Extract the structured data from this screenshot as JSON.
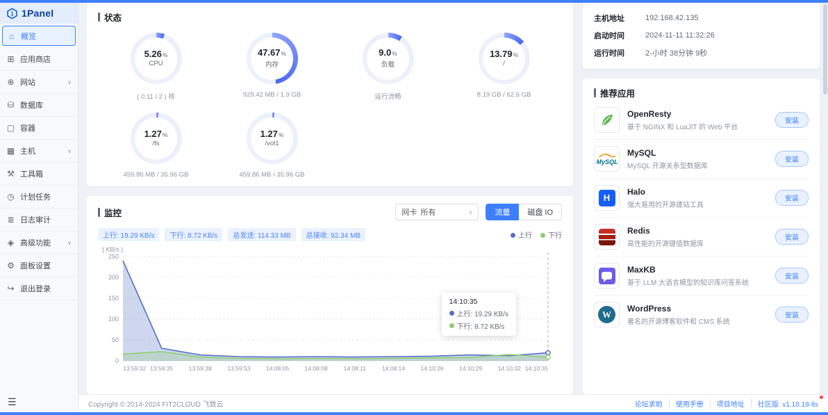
{
  "colors": {
    "primary": "#3d7fff",
    "up_series": "#5470c6",
    "down_series": "#91cc75",
    "danger": "#f54a45"
  },
  "app": {
    "logo_text": "1Panel"
  },
  "sidebar": {
    "items": [
      {
        "label": "概览",
        "selected": true
      },
      {
        "label": "应用商店"
      },
      {
        "label": "网站",
        "expandable": true
      },
      {
        "label": "数据库"
      },
      {
        "label": "容器"
      },
      {
        "label": "主机",
        "expandable": true
      },
      {
        "label": "工具箱"
      },
      {
        "label": "计划任务"
      },
      {
        "label": "日志审计"
      },
      {
        "label": "高级功能",
        "expandable": true
      },
      {
        "label": "面板设置"
      },
      {
        "label": "退出登录"
      }
    ]
  },
  "status": {
    "title": "状态",
    "gauges": [
      {
        "value": "5.26",
        "unit": "%",
        "label": "CPU",
        "sub": "( 0.11 / 2 ) 核",
        "percent": 5.26
      },
      {
        "value": "47.67",
        "unit": "%",
        "label": "内存",
        "sub": "929.42 MB / 1.9 GB",
        "percent": 47.67
      },
      {
        "value": "9.0",
        "unit": "%",
        "label": "负载",
        "sub": "运行流畅",
        "percent": 9.0
      },
      {
        "value": "13.79",
        "unit": "%",
        "label": "/",
        "sub": "8.19 GB / 62.6 GB",
        "percent": 13.79
      },
      {
        "value": "1.27",
        "unit": "%",
        "label": "/fs",
        "sub": "459.86 MB / 35.96 GB",
        "percent": 1.27
      },
      {
        "value": "1.27",
        "unit": "%",
        "label": "/vol1",
        "sub": "459.86 MB / 35.96 GB",
        "percent": 1.27
      }
    ]
  },
  "monitor": {
    "title": "监控",
    "select_prefix": "网卡",
    "select_value": "所有",
    "traffic_btn": "流量",
    "disk_btn": "磁盘 IO",
    "tags": [
      "上行: 19.29 KB/s",
      "下行: 8.72 KB/s",
      "总发送: 114.33 MB",
      "总接收: 92.34 MB"
    ],
    "tooltip": {
      "time": "14:10:35",
      "up": "上行: 19.29 KB/s",
      "down": "下行: 8.72 KB/s"
    }
  },
  "chart_data": {
    "type": "area",
    "title": "监控 - 网络流量",
    "xlabel": "",
    "ylabel": "( KB/s )",
    "ylim": [
      0,
      250
    ],
    "grid": true,
    "legend_position": "top-right",
    "x": [
      "13:59:32",
      "13:59:35",
      "13:59:38",
      "13:59:53",
      "14:08:05",
      "14:08:08",
      "14:08:11",
      "14:08:14",
      "14:10:26",
      "14:10:29",
      "14:10:32",
      "14:10:35"
    ],
    "series": [
      {
        "name": "上行",
        "color": "#5470c6",
        "values": [
          240,
          30,
          14,
          10,
          9,
          10,
          9,
          10,
          11,
          14,
          12,
          19.29
        ]
      },
      {
        "name": "下行",
        "color": "#91cc75",
        "values": [
          16,
          22,
          9,
          6,
          5,
          6,
          5,
          6,
          7,
          8,
          15,
          8.72
        ]
      }
    ]
  },
  "host_info": {
    "rows": [
      {
        "label": "主机地址",
        "value": "192.168.42.135"
      },
      {
        "label": "启动时间",
        "value": "2024-11-11 11:32:26"
      },
      {
        "label": "运行时间",
        "value": "2-小时 38分钟 9秒"
      }
    ]
  },
  "apps": {
    "title": "推荐应用",
    "install_label": "安装",
    "items": [
      {
        "name": "OpenResty",
        "desc": "基于 NGINX 和 LuaJIT 的 Web 平台"
      },
      {
        "name": "MySQL",
        "desc": "MySQL 开源关系型数据库"
      },
      {
        "name": "Halo",
        "desc": "强大易用的开源建站工具"
      },
      {
        "name": "Redis",
        "desc": "高性能的开源键值数据库"
      },
      {
        "name": "MaxKB",
        "desc": "基于 LLM 大语言模型的知识库问答系统"
      },
      {
        "name": "WordPress",
        "desc": "著名的开源博客软件和 CMS 系统"
      }
    ]
  },
  "footer": {
    "copyright": "Copyright © 2014-2024 FIT2CLOUD 飞致云",
    "links": [
      "论坛求助",
      "使用手册",
      "项目地址"
    ],
    "version": "社区版: v1.10.18-lts"
  }
}
